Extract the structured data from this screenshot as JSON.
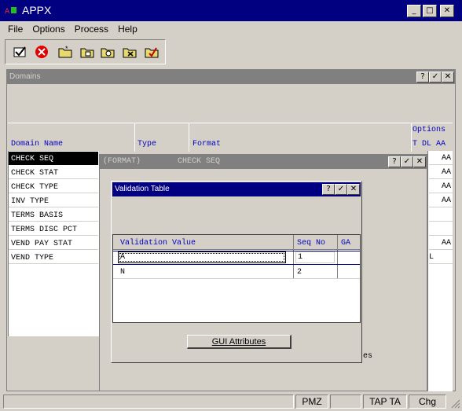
{
  "app": {
    "title": "APPX"
  },
  "menu": [
    "File",
    "Options",
    "Process",
    "Help"
  ],
  "toolbar": {
    "icons": [
      "checkmark-icon",
      "cancel-icon",
      "folder-new-icon",
      "folder-edit-icon",
      "folder-search-icon",
      "folder-delete-icon",
      "folder-check-icon"
    ]
  },
  "domains": {
    "title": "Domains",
    "headers": {
      "name": "Domain Name",
      "type": "Type",
      "format": "Format",
      "options": "Options",
      "opt_cols": "T DL AA"
    },
    "rows": [
      {
        "name": "CHECK SEQ",
        "opt": "AA",
        "selected": true
      },
      {
        "name": "CHECK STAT",
        "opt": "AA"
      },
      {
        "name": "CHECK TYPE",
        "opt": "AA"
      },
      {
        "name": "INV TYPE",
        "opt": "AA"
      },
      {
        "name": "TERMS BASIS",
        "opt": ""
      },
      {
        "name": "TERMS DISC PCT",
        "opt": ""
      },
      {
        "name": "VEND PAY STAT",
        "opt": "AA"
      },
      {
        "name": "VEND TYPE",
        "opt": "L"
      }
    ],
    "bottom_fragment": "es"
  },
  "format_window": {
    "title_left": "(FORMAT)",
    "title_right": "CHECK SEQ"
  },
  "validation": {
    "title": "Validation Table",
    "headers": {
      "value": "Validation Value",
      "seq": "Seq No",
      "ga": "GA"
    },
    "rows": [
      {
        "value": "A",
        "seq": "1"
      },
      {
        "value": "N",
        "seq": "2"
      }
    ],
    "gui_button": "GUI Attributes"
  },
  "status": {
    "cells": [
      "PMZ",
      "TAP TA",
      "Chg"
    ]
  }
}
